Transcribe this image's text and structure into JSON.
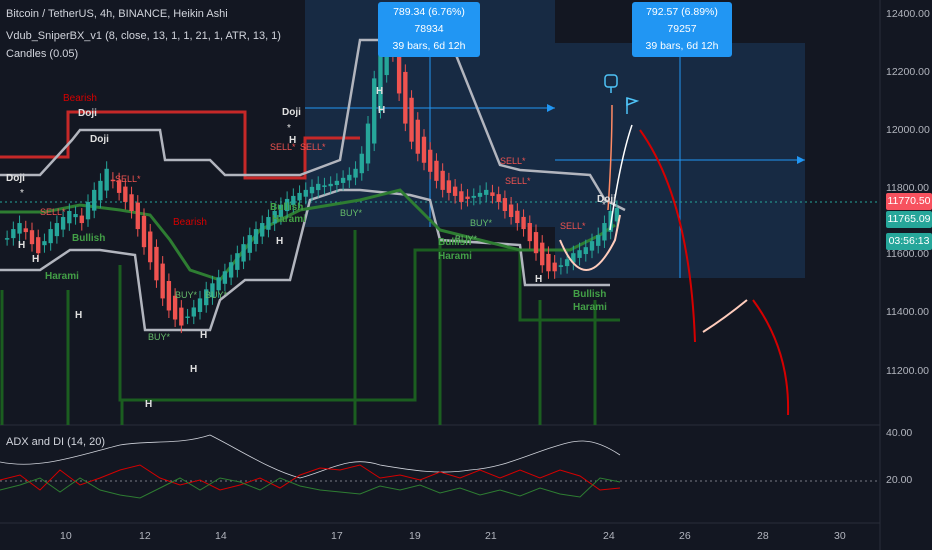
{
  "header": {
    "symbol_line": "Bitcoin / TetherUS, 4h, BINANCE, Heikin Ashi",
    "indicator_line": "Vdub_SniperBX_v1 (8, close, 13, 1, 1, 21, 1, ATR, 13, 1)",
    "candles_line": "Candles (0.05)"
  },
  "oscillator": {
    "title": "ADX and DI (14, 20)",
    "ticks": [
      "40.00",
      "20.00"
    ]
  },
  "price_axis": {
    "ticks": [
      "12400.00",
      "12200.00",
      "12000.00",
      "11800.00",
      "11600.00",
      "11400.00",
      "11200.00"
    ]
  },
  "price_tags": {
    "last": "11770.50",
    "second": "11765.09",
    "countdown": "03:56:13"
  },
  "time_axis": {
    "ticks": [
      "10",
      "12",
      "14",
      "17",
      "19",
      "21",
      "24",
      "26",
      "28",
      "30"
    ]
  },
  "measure_boxes": [
    {
      "line1": "789.34 (6.76%) 78934",
      "line2": "39 bars, 6d 12h"
    },
    {
      "line1": "792.57 (6.89%) 79257",
      "line2": "39 bars, 6d 12h"
    }
  ],
  "annotations": {
    "bearish": "Bearish",
    "doji": "Doji",
    "harami": "Harami",
    "bullish": "Bullish",
    "sell": "SELL*",
    "buy": "BUY*",
    "h": "H",
    "star": "*"
  },
  "colors": {
    "up": "#26a69a",
    "down": "#ef5350",
    "bg": "#131722",
    "box": "#1c3a5e",
    "accent": "#2196f3"
  },
  "chart_data": {
    "type": "candlestick",
    "price_range": [
      11050,
      12460
    ],
    "x_date_ticks": [
      "10",
      "12",
      "14",
      "17",
      "19",
      "21",
      "24",
      "26",
      "28",
      "30"
    ],
    "close": [
      11670,
      11700,
      11720,
      11690,
      11650,
      11620,
      11660,
      11700,
      11720,
      11740,
      11760,
      11750,
      11720,
      11790,
      11830,
      11860,
      11900,
      11860,
      11820,
      11790,
      11760,
      11700,
      11640,
      11590,
      11530,
      11470,
      11430,
      11400,
      11380,
      11410,
      11440,
      11470,
      11500,
      11520,
      11540,
      11560,
      11590,
      11620,
      11650,
      11680,
      11700,
      11720,
      11740,
      11760,
      11780,
      11800,
      11810,
      11820,
      11830,
      11840,
      11850,
      11845,
      11850,
      11860,
      11870,
      11880,
      11900,
      11950,
      12050,
      12200,
      12330,
      12400,
      12280,
      12150,
      12050,
      11990,
      11950,
      11920,
      11890,
      11860,
      11830,
      11820,
      11810,
      11790,
      11800,
      11810,
      11820,
      11830,
      11810,
      11790,
      11760,
      11740,
      11720,
      11700,
      11660,
      11620,
      11580,
      11560,
      11560,
      11580,
      11600,
      11620,
      11630,
      11640,
      11660,
      11680,
      11720,
      11760,
      11770
    ]
  }
}
